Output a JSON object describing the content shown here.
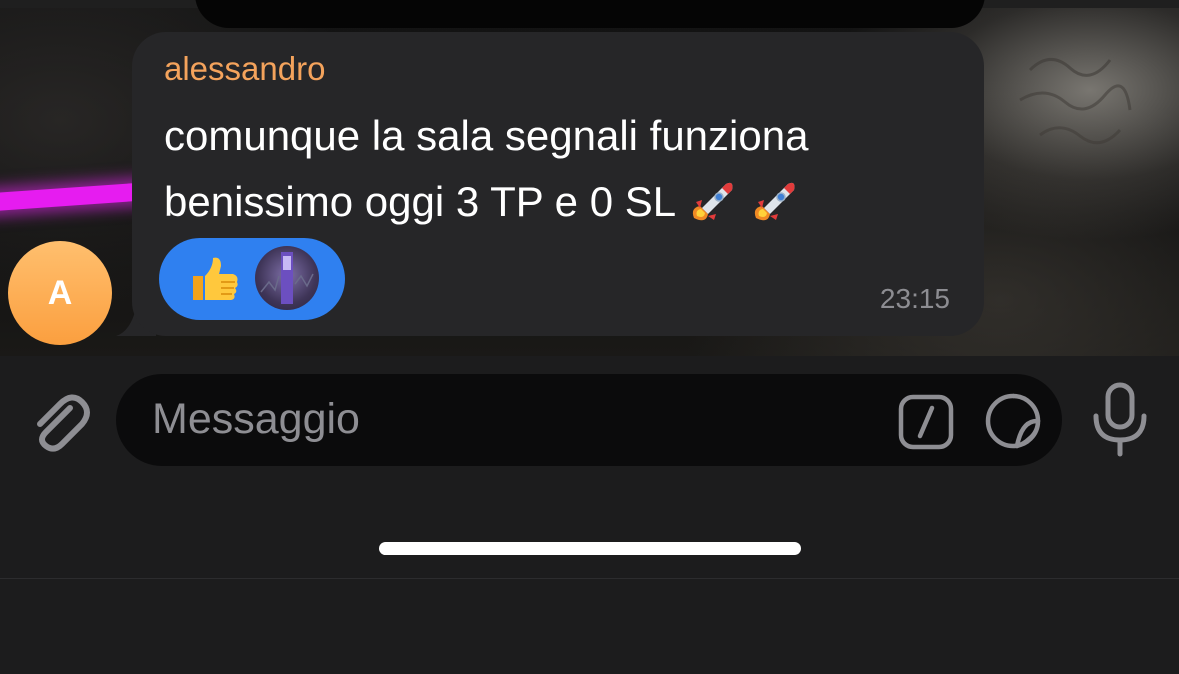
{
  "message": {
    "sender": "alessandro",
    "lines": [
      "comunque la sala segnali funziona",
      "benissimo oggi 3 TP e 0 SL"
    ],
    "emojis": [
      "rocket-emoji",
      "rocket-emoji"
    ],
    "time": "23:15",
    "reactions": {
      "emoji": "thumbs-up-emoji",
      "reactor": "reactor-avatar"
    }
  },
  "avatar": {
    "initial": "A",
    "color": "#fb9f3f"
  },
  "composer": {
    "placeholder": "Messaggio",
    "icons": [
      "paperclip-icon",
      "command-icon",
      "sticker-icon",
      "microphone-icon"
    ]
  },
  "colors": {
    "sender_name": "#f4a35c",
    "bubble": "#262628",
    "reaction_pill": "#2f80f0",
    "background": "#1c1c1d"
  }
}
